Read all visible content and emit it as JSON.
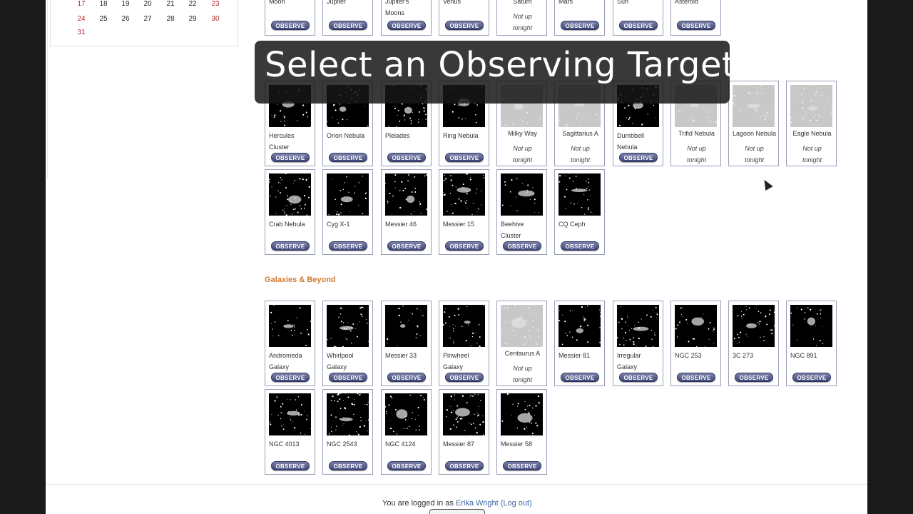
{
  "calendar": {
    "rows": [
      [
        "17",
        "18",
        "19",
        "20",
        "21",
        "22",
        "23"
      ],
      [
        "24",
        "25",
        "26",
        "27",
        "28",
        "29",
        "30"
      ],
      [
        "31"
      ]
    ]
  },
  "overlay": {
    "title": "Select an Observing Target"
  },
  "solar_system": [
    {
      "name": "Moon",
      "button": "OBSERVE"
    },
    {
      "name": "Jupiter",
      "button": "OBSERVE"
    },
    {
      "name": "Jupiter's Moons",
      "button": "OBSERVE"
    },
    {
      "name": "Venus",
      "button": "OBSERVE"
    },
    {
      "name": "Saturn",
      "status_1": "Not up",
      "status_2": "tonight"
    },
    {
      "name": "Mars",
      "button": "OBSERVE"
    },
    {
      "name": "Sun",
      "button": "OBSERVE"
    },
    {
      "name": "Asteroid",
      "button": "OBSERVE"
    }
  ],
  "stars_nebulae": [
    {
      "name": "Hercules Cluster",
      "button": "OBSERVE"
    },
    {
      "name": "Orion Nebula",
      "button": "OBSERVE"
    },
    {
      "name": "Pleiades",
      "button": "OBSERVE"
    },
    {
      "name": "Ring Nebula",
      "button": "OBSERVE"
    },
    {
      "name": "Milky Way",
      "status_1": "Not up",
      "status_2": "tonight"
    },
    {
      "name": "Sagittarius A",
      "status_1": "Not up",
      "status_2": "tonight"
    },
    {
      "name": "Dumbbell Nebula",
      "button": "OBSERVE"
    },
    {
      "name": "Trifid Nebula",
      "status_1": "Not up",
      "status_2": "tonight"
    },
    {
      "name": "Lagoon Nebula",
      "status_1": "Not up",
      "status_2": "tonight"
    },
    {
      "name": "Eagle Nebula",
      "status_1": "Not up",
      "status_2": "tonight"
    },
    {
      "name": "Crab Nebula",
      "button": "OBSERVE"
    },
    {
      "name": "Cyg X-1",
      "button": "OBSERVE"
    },
    {
      "name": "Messier 46",
      "button": "OBSERVE"
    },
    {
      "name": "Messier 15",
      "button": "OBSERVE"
    },
    {
      "name": "Beehive Cluster",
      "button": "OBSERVE"
    },
    {
      "name": "CQ Ceph",
      "button": "OBSERVE"
    }
  ],
  "galaxies_heading": "Galaxies & Beyond",
  "galaxies": [
    {
      "name": "Andromeda Galaxy",
      "button": "OBSERVE"
    },
    {
      "name": "Whirlpool Galaxy",
      "button": "OBSERVE"
    },
    {
      "name": "Messier 33",
      "button": "OBSERVE"
    },
    {
      "name": "Pinwheel Galaxy",
      "button": "OBSERVE"
    },
    {
      "name": "Centaurus A",
      "status_1": "Not up",
      "status_2": "tonight"
    },
    {
      "name": "Messier 81",
      "button": "OBSERVE"
    },
    {
      "name": "Irregular Galaxy",
      "button": "OBSERVE"
    },
    {
      "name": "NGC 253",
      "button": "OBSERVE"
    },
    {
      "name": "3C 273",
      "button": "OBSERVE"
    },
    {
      "name": "NGC 891",
      "button": "OBSERVE"
    },
    {
      "name": "NGC 4013",
      "button": "OBSERVE"
    },
    {
      "name": "NGC 2543",
      "button": "OBSERVE"
    },
    {
      "name": "NGC 4124",
      "button": "OBSERVE"
    },
    {
      "name": "Messier 87",
      "button": "OBSERVE"
    },
    {
      "name": "Messier 58",
      "button": "OBSERVE"
    }
  ],
  "footer": {
    "prefix": "You are logged in as",
    "user": "Erika Wright",
    "logout": "(Log out)"
  },
  "colors": {
    "accent_heading": "#d27a32",
    "button_top": "#7d84aa",
    "button_bottom": "#3e4679",
    "weekend": "#b3282d",
    "link": "#3d6aa5"
  }
}
